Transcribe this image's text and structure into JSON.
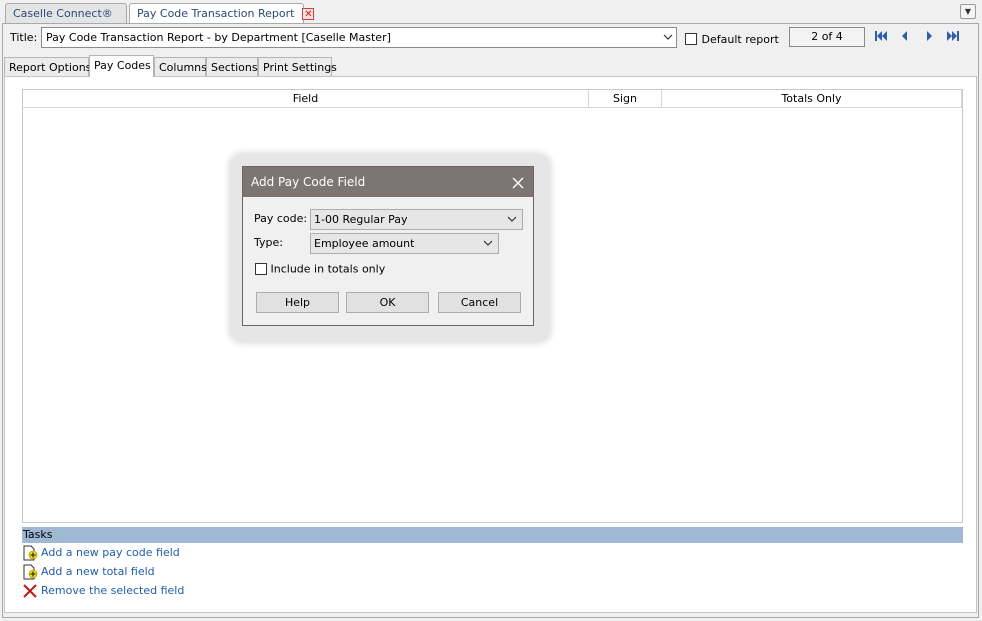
{
  "tabs": [
    {
      "label": "Caselle Connect®"
    },
    {
      "label": "Pay Code Transaction Report"
    }
  ],
  "title_row": {
    "label": "Title:",
    "value": "Pay Code Transaction Report - by Department [Caselle Master]",
    "default_report_label": "Default report",
    "page_indicator": "2 of 4"
  },
  "inner_tabs": [
    {
      "label": "Report Options"
    },
    {
      "label": "Pay Codes"
    },
    {
      "label": "Columns"
    },
    {
      "label": "Sections"
    },
    {
      "label": "Print Settings"
    }
  ],
  "grid": {
    "columns": [
      "Field",
      "Sign",
      "Totals Only"
    ]
  },
  "tasks": {
    "header": "Tasks",
    "items": [
      {
        "label": "Add a new pay code field",
        "icon": "add-document-icon"
      },
      {
        "label": "Add a new total field",
        "icon": "add-document-icon"
      },
      {
        "label": "Remove the selected field",
        "icon": "red-x-icon"
      }
    ]
  },
  "dialog": {
    "title": "Add Pay Code Field",
    "pay_code_label": "Pay code:",
    "pay_code_value": "1-00 Regular Pay",
    "type_label": "Type:",
    "type_value": "Employee amount",
    "include_totals_label": "Include in totals only",
    "help_label": "Help",
    "ok_label": "OK",
    "cancel_label": "Cancel"
  },
  "colors": {
    "dialog_title_bar": "#7c7573",
    "tasks_header": "#9fb8d3",
    "link": "#1f5ea8"
  }
}
